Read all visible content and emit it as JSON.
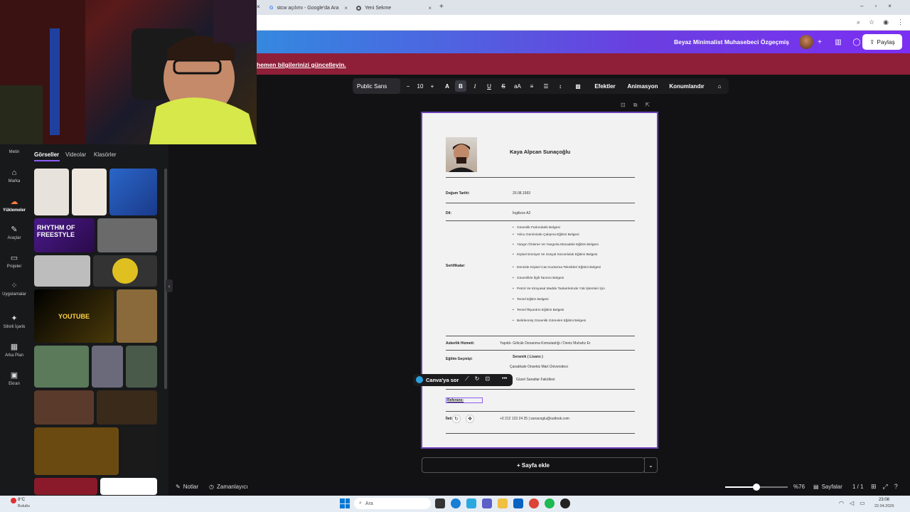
{
  "browser": {
    "tabs": [
      {
        "label": "stcw açılımı - Google'da Ara"
      },
      {
        "label": "Yeni Sekme"
      }
    ],
    "new_tab": "+"
  },
  "header": {
    "doc_title": "Beyaz Minimalist Muhasebeci Özgeçmiş",
    "share_label": "Paylaş",
    "banner_text": "hemen bilgilerinizi güncelleyin."
  },
  "toolbar": {
    "font": "Public Sans",
    "minus": "−",
    "font_size": "10",
    "plus": "+",
    "effects": "Efektler",
    "animation": "Animasyon",
    "position": "Konumlandır"
  },
  "rail": [
    {
      "label": "Metin",
      "icon": "text-icon"
    },
    {
      "label": "Marka",
      "icon": "brand-icon"
    },
    {
      "label": "Yüklemeler",
      "icon": "cloud-upload-icon"
    },
    {
      "label": "Araçlar",
      "icon": "pen-icon"
    },
    {
      "label": "Projeler",
      "icon": "folder-icon"
    },
    {
      "label": "Uygulamalar",
      "icon": "apps-icon"
    },
    {
      "label": "Sihirli İçerik",
      "icon": "magic-icon"
    },
    {
      "label": "Arka Plan",
      "icon": "background-icon"
    },
    {
      "label": "Ekran",
      "icon": "screen-icon"
    }
  ],
  "panel": {
    "tabs": [
      "Görseller",
      "Videolar",
      "Klasörler"
    ],
    "thumb_texts": {
      "freestyle": "RHYTHM OF FREESTYLE",
      "youtube": "YOUTUBE"
    }
  },
  "resume": {
    "name": "Kaya Alpcan Sunaçoğlu",
    "dob_label": "Doğum Tarihi:",
    "dob_value": "20.08.1993",
    "lang_label": "Dil:",
    "lang_value": "İngilizce A2",
    "cert_label": "Sertifikalar:",
    "certs": [
      "Güvenlik Farkındalık Belgesi",
      "Yolcu Gemisinde Çalışma Eğitimi Belgesi",
      "Yangın Önleme Ve Yangınla Mücadele Eğitimi Belgesi",
      "Kişisel Emniyet Ve Sosyal Sorumluluk Eğitimi Belgesi",
      "Denizde Kişisel Can Kurtarma Teknikleri Eğitimi Belgesi",
      "Güvenlikle İlgili Tanıtım Belgesi",
      "Petrol Ve Kimyasal Madde Tankerlerinde Yük İşlemleri İçin",
      "Temel Eğitim Belgesi",
      "Temel İlkyardım Eğitimi Belgesi",
      "Belirlenmiş Güvenlik Görevleri Eğitimi Belgesi"
    ],
    "military_label": "Askerlik Hizmeti:",
    "military_value": "Yapıldı- Gölcük Donanma Komutanlığı / Deniz Muhafız Er",
    "edu_label": "Eğitim Geçmişi:",
    "edu_degree": "Seramik ( Lisans )",
    "edu_uni": "Çanakkale Onsekiz Mart Üniversitesi",
    "edu_faculty": "Güzel Sanatlar Fakültesi",
    "ref_label": "Referans:",
    "contact_label": "İleti",
    "contact_value": "+0 212 123 24 25 | sunacoglu@outlook.com"
  },
  "context_menu": {
    "ask": "Canva'ya sor",
    "more": "•••"
  },
  "bottom": {
    "add_page": "+ Sayfa ekle",
    "notes": "Notlar",
    "timer": "Zamanlayıcı",
    "zoom": "%76",
    "pages": "Sayfalar",
    "page_count": "1 / 1",
    "zoom_fraction": 0.5
  },
  "taskbar": {
    "weather_temp": "8°C",
    "weather_desc": "Bulutlu",
    "search_placeholder": "Ara",
    "time": "23:08",
    "date": "22.04.2026"
  }
}
